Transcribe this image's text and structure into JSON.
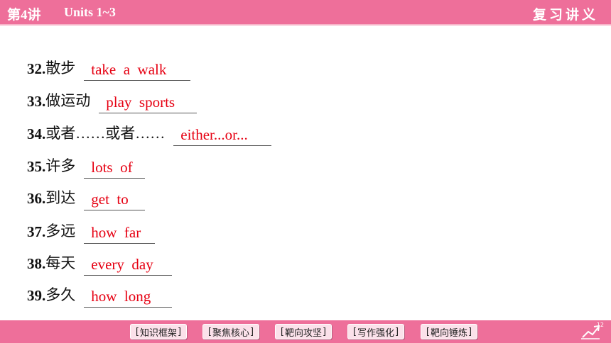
{
  "header": {
    "lesson": "第4讲",
    "units": "Units 1~3",
    "review": "复习讲义"
  },
  "items": [
    {
      "num": "32.",
      "cn": "散步",
      "answer": "take  a  walk"
    },
    {
      "num": "33.",
      "cn": "做运动",
      "answer": "play  sports"
    },
    {
      "num": "34.",
      "cn": "或者……或者……",
      "answer": "either...or..."
    },
    {
      "num": "35.",
      "cn": "许多",
      "answer": "lots  of"
    },
    {
      "num": "36.",
      "cn": "到达",
      "answer": "get  to"
    },
    {
      "num": "37.",
      "cn": "多远",
      "answer": "how  far"
    },
    {
      "num": "38.",
      "cn": "每天",
      "answer": "every  day"
    },
    {
      "num": "39.",
      "cn": "多久",
      "answer": "how  long"
    }
  ],
  "footer": {
    "nav": [
      "知识框架",
      "聚焦核心",
      "靶向攻坚",
      "写作强化",
      "靶向锤炼"
    ],
    "page": "12"
  },
  "colors": {
    "header_bg": "#ee6f9a",
    "answer": "#e60012"
  },
  "icons": {
    "page_icon": "return-arrow-icon"
  }
}
